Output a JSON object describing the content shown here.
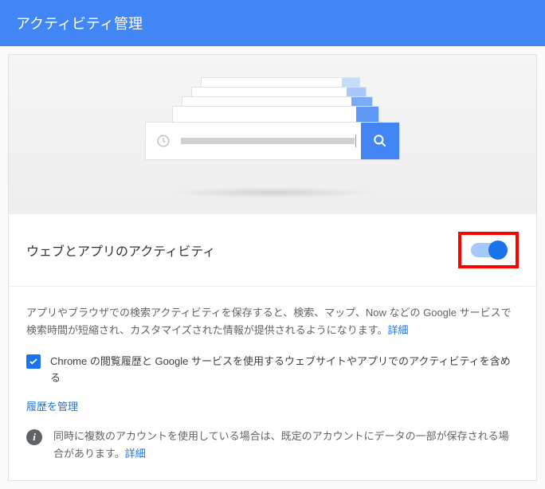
{
  "header": {
    "title": "アクティビティ管理"
  },
  "section": {
    "title": "ウェブとアプリのアクティビティ",
    "toggle_on": true
  },
  "description": {
    "text": "アプリやブラウザでの検索アクティビティを保存すると、検索、マップ、Now などの Google サービスで検索時間が短縮され、カスタマイズされた情報が提供されるようになります。",
    "learn_more": "詳細"
  },
  "checkbox": {
    "checked": true,
    "label": "Chrome の閲覧履歴と Google サービスを使用するウェブサイトやアプリでのアクティビティを含める"
  },
  "manage_link": "履歴を管理",
  "info": {
    "text": "同時に複数のアカウントを使用している場合は、既定のアカウントにデータの一部が保存される場合があります。",
    "learn_more": "詳細"
  }
}
